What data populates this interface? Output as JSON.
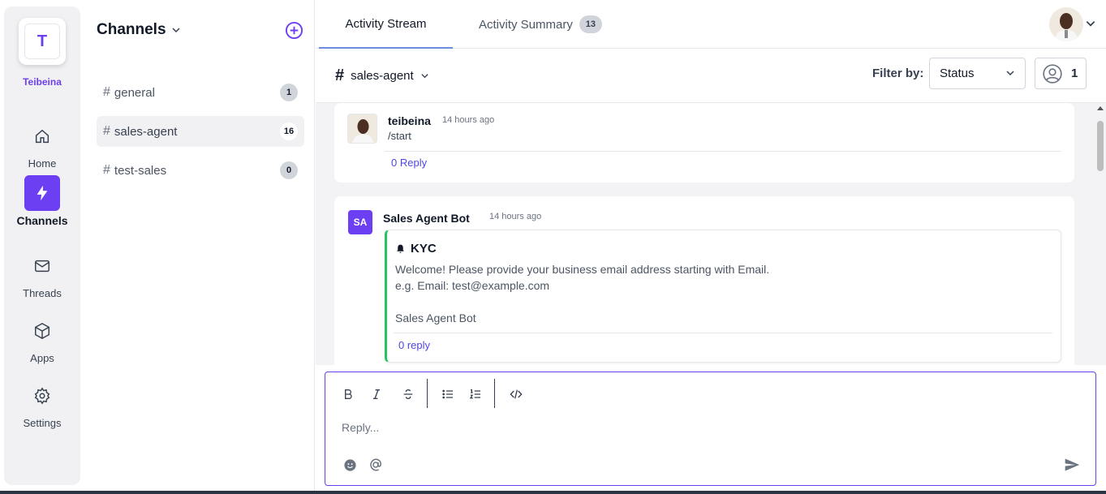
{
  "workspace": {
    "initial": "T",
    "name": "Teibeina"
  },
  "nav": [
    {
      "label": "Home",
      "icon": "home-icon"
    },
    {
      "label": "Channels",
      "icon": "bolt-icon",
      "active": true
    },
    {
      "label": "Threads",
      "icon": "mail-icon"
    },
    {
      "label": "Apps",
      "icon": "cube-icon"
    },
    {
      "label": "Settings",
      "icon": "gear-icon"
    }
  ],
  "channels_panel": {
    "title": "Channels",
    "items": [
      {
        "name": "general",
        "count": "1"
      },
      {
        "name": "sales-agent",
        "count": "16",
        "active": true
      },
      {
        "name": "test-sales",
        "count": "0"
      }
    ]
  },
  "tabs": [
    {
      "label": "Activity Stream",
      "active": true
    },
    {
      "label": "Activity Summary",
      "badge": "13"
    }
  ],
  "channel_bar": {
    "channel": "sales-agent",
    "filter_label": "Filter by:",
    "filter_value": "Status",
    "member_count": "1"
  },
  "messages": [
    {
      "author": "teibeina",
      "time": "14 hours ago",
      "text": "/start",
      "reply": "0 Reply"
    },
    {
      "avatar_initials": "SA",
      "author": "Sales Agent Bot",
      "time": "14 hours ago",
      "card": {
        "title": "KYC",
        "line1": "Welcome! Please provide your business email address starting with Email.",
        "line2": "e.g. Email: test@example.com",
        "signature": "Sales Agent Bot",
        "reply": "0 reply"
      }
    }
  ],
  "composer": {
    "placeholder": "Reply..."
  },
  "colors": {
    "accent": "#6d3ff3",
    "kyc_border": "#22c55e",
    "link": "#4f46e5"
  }
}
